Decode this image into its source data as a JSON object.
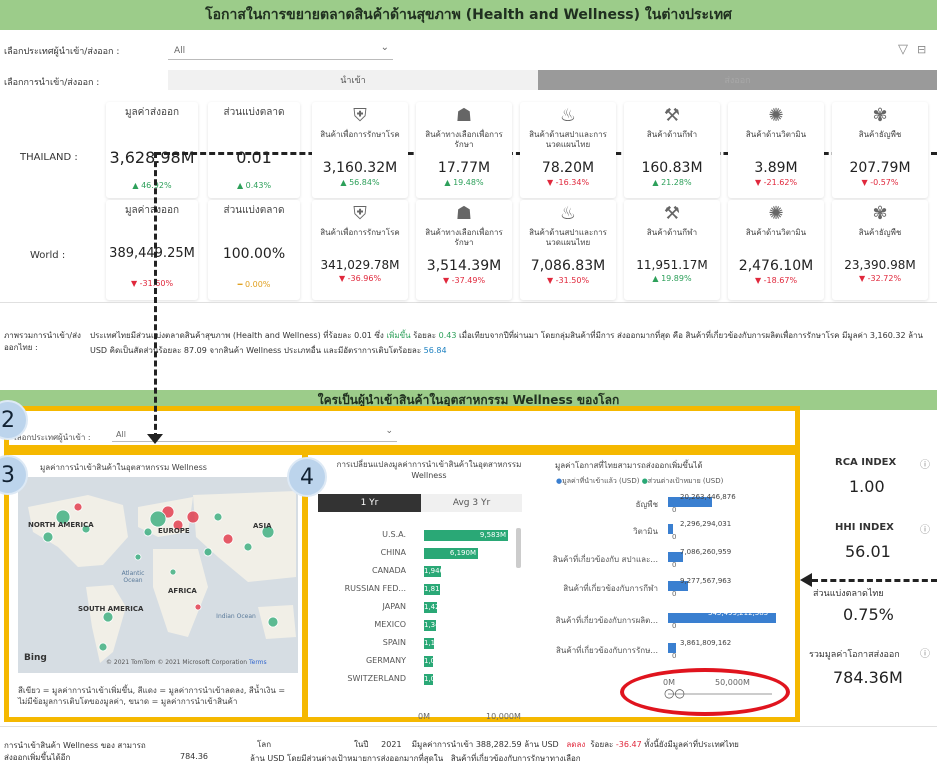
{
  "header": {
    "title": "โอกาสในการขยายตลาดสินค้าด้านสุขภาพ (Health and Wellness) ในต่างประเทศ"
  },
  "filters": {
    "country_label": "เลือกประเทศผู้นำเข้า/ส่งออก :",
    "country_value": "All",
    "mode_label": "เลือกการนำเข้า/ส่งออก :",
    "mode_import": "นำเข้า",
    "mode_export": "ส่งออก"
  },
  "kpi_headers": {
    "export_value": "มูลค่าส่งออก",
    "market_share": "ส่วนแบ่งตลาด"
  },
  "thailand": {
    "label": "THAILAND :",
    "export_value": "3,628.98M",
    "export_change": "▲ 46.92%",
    "market_share": "0.01",
    "share_change": "▲ 0.43%",
    "products": [
      {
        "icon": "shield-icon",
        "glyph": "⛨",
        "title": "สินค้าเพื่อการรักษาโรค",
        "value": "3,160.32M",
        "change": "▲ 56.84%",
        "dir": "up"
      },
      {
        "icon": "alt-medicine-icon",
        "glyph": "☗",
        "title": "สินค้าทางเลือกเพื่อการรักษา",
        "value": "17.77M",
        "change": "▲ 19.48%",
        "dir": "up"
      },
      {
        "icon": "spa-icon",
        "glyph": "♨",
        "title": "สินค้าด้านสปาและการนวดแผนไทย",
        "value": "78.20M",
        "change": "▼ -16.34%",
        "dir": "down"
      },
      {
        "icon": "sport-icon",
        "glyph": "⚒",
        "title": "สินค้าด้านกีฬา",
        "value": "160.83M",
        "change": "▲ 21.28%",
        "dir": "up"
      },
      {
        "icon": "vitamin-icon",
        "glyph": "✺",
        "title": "สินค้าด้านวิตามิน",
        "value": "3.89M",
        "change": "▼ -21.62%",
        "dir": "down"
      },
      {
        "icon": "grain-icon",
        "glyph": "✾",
        "title": "สินค้าธัญพืช",
        "value": "207.79M",
        "change": "▼ -0.57%",
        "dir": "down"
      }
    ]
  },
  "world": {
    "label": "World :",
    "export_value": "389,449.25M",
    "export_change": "▼ -31.60%",
    "market_share": "100.00%",
    "share_change": "━ 0.00%",
    "products": [
      {
        "icon": "shield-icon",
        "glyph": "⛨",
        "title": "สินค้าเพื่อการรักษาโรค",
        "value": "341,029.78M",
        "change": "▼ -36.96%",
        "dir": "down"
      },
      {
        "icon": "alt-medicine-icon",
        "glyph": "☗",
        "title": "สินค้าทางเลือกเพื่อการรักษา",
        "value": "3,514.39M",
        "change": "▼ -37.49%",
        "dir": "down"
      },
      {
        "icon": "spa-icon",
        "glyph": "♨",
        "title": "สินค้าด้านสปาและการนวดแผนไทย",
        "value": "7,086.83M",
        "change": "▼ -31.50%",
        "dir": "down"
      },
      {
        "icon": "sport-icon",
        "glyph": "⚒",
        "title": "สินค้าด้านกีฬา",
        "value": "11,951.17M",
        "change": "▲ 19.89%",
        "dir": "up"
      },
      {
        "icon": "vitamin-icon",
        "glyph": "✺",
        "title": "สินค้าด้านวิตามิน",
        "value": "2,476.10M",
        "change": "▼ -18.67%",
        "dir": "down"
      },
      {
        "icon": "grain-icon",
        "glyph": "✾",
        "title": "สินค้าธัญพืช",
        "value": "23,390.98M",
        "change": "▼ -32.72%",
        "dir": "down"
      }
    ]
  },
  "summary": {
    "label": "ภาพรวมการนำเข้า/ส่งออกไทย :",
    "text1": "ประเทศไทยมีส่วนแบ่งตลาดสินค้าสุขภาพ (Health and Wellness) ที่ร้อยละ",
    "share": "0.01",
    "text2": "ซึ่ง",
    "trend": "เพิ่มขึ้น",
    "text3": "ร้อยละ",
    "pct": "0.43",
    "text4": "เมื่อเทียบจากปีที่ผ่านมา โดยกลุ่มสินค้าที่มีการ ส่งออกมากที่สุด คือ",
    "text5": "สินค้าที่เกี่ยวข้องกับการผลิตเพื่อการรักษาโรค",
    "text6": "มีมูลค่า",
    "value": "3,160.32",
    "text7": "ล้าน USD คิดเป็นสัดส่วนร้อยละ",
    "ratio": "87.09",
    "text8": "จากสินค้า Wellness ประเภทอื่น และมีอัตราการเติบโตร้อยละ",
    "growth": "56.84"
  },
  "section2": {
    "title": "ใครเป็นผู้นำเข้าสินค้าในอุตสาหกรรม Wellness ของโลก",
    "filter_label": "เลือกประเทศผู้นำเข้า :",
    "filter_value": "All"
  },
  "bubbles": [
    "2",
    "3",
    "4"
  ],
  "map": {
    "title": "มูลค่าการนำเข้าสินค้าในอุตสาหกรรม Wellness",
    "labels": [
      "NORTH AMERICA",
      "EUROPE",
      "ASIA",
      "Atlantic Ocean",
      "AFRICA",
      "SOUTH AMERICA",
      "Indian Ocean"
    ],
    "bing": "Bing",
    "copyright": "© 2021 TomTom © 2021 Microsoft Corporation",
    "terms": "Terms",
    "legend": "สีเขียว = มูลค่าการนำเข้าเพิ่มขึ้น, สีแดง = มูลค่าการนำเข้าลดลง, สีน้ำเงิน = ไม่มีข้อมูลการเติบโตของมูลค่า, ขนาด = มูลค่าการนำเข้าสินค้า"
  },
  "importers": {
    "title": "การเปลี่ยนแปลงมูลค่าการนำเข้าสินค้าในอุตสาหกรรม Wellness",
    "tab_1yr": "1 Yr",
    "tab_3yr": "Avg 3 Yr",
    "axis_min": "0M",
    "axis_max": "10,000M"
  },
  "opportunity": {
    "title": "มูลค่าโอกาสที่ไทยสามารถส่งออกเพิ่มขึ้นได้",
    "legend_import": "มูลค่าที่นำเข้าแล้ว (USD)",
    "legend_target": "ส่วนต่างเป้าหมาย (USD)",
    "axis_min": "0M",
    "axis_max": "50,000M"
  },
  "kpis": {
    "rca_label": "RCA INDEX",
    "rca_value": "1.00",
    "hhi_label": "HHI INDEX",
    "hhi_value": "56.01",
    "share_label": "ส่วนแบ่งตลาดไทย",
    "share_value": "0.75%",
    "total_label": "รวมมูลค่าโอกาสส่งออก",
    "total_value": "784.36M"
  },
  "footer": {
    "label": "การนำเข้าสินค้า Wellness ของ สามารถส่งออกเพิ่มขึ้นได้อีก",
    "world": "โลก",
    "amount": "784.36",
    "in_year": "ในปี",
    "year": "2021",
    "text1": "มีมูลค่าการนำเข้า",
    "import_value": "388,282.59",
    "text2": "ล้าน USD",
    "trend": "ลดลง",
    "text3": "ร้อยละ",
    "pct": "-36.47",
    "text4": "ทั้งนี้ยังมีมูลค่าที่ประเทศไทย",
    "text5": "ล้าน USD โดยมีส่วนต่างเป้าหมายการส่งออกมากที่สุดใน",
    "text6": "สินค้าที่เกี่ยวข้องกับการรักษาทางเลือก"
  },
  "chart_data": [
    {
      "type": "bar",
      "title": "การเปลี่ยนแปลงมูลค่าการนำเข้าสินค้าในอุตสาหกรรม Wellness",
      "orientation": "horizontal",
      "categories": [
        "U.S.A.",
        "CHINA",
        "CANADA",
        "RUSSIAN FED...",
        "JAPAN",
        "MEXICO",
        "SPAIN",
        "GERMANY",
        "SWITZERLAND"
      ],
      "values": [
        9583,
        6190,
        1946,
        1813,
        1422,
        1347,
        1135,
        1064,
        1031
      ],
      "value_labels": [
        "9,583M",
        "6,190M",
        "1,946M",
        "1,813M",
        "1,422M",
        "1,347M",
        "1,135M",
        "1,064M",
        "1,031M"
      ],
      "xlim": [
        0,
        10000
      ],
      "color": "#2aa876"
    },
    {
      "type": "bar",
      "title": "มูลค่าโอกาสที่ไทยสามารถส่งออกเพิ่มขึ้นได้",
      "orientation": "horizontal",
      "categories": [
        "ธัญพืช",
        "วิตามิน",
        "สินค้าที่เกี่ยวข้องกับ สปาและ...",
        "สินค้าที่เกี่ยวข้องกับการกีฬา",
        "สินค้าที่เกี่ยวข้องกับการผลิต...",
        "สินค้าที่เกี่ยวข้องกับการรักษ..."
      ],
      "series": [
        {
          "name": "มูลค่าที่นำเข้าแล้ว (USD)",
          "values": [
            20263446876,
            2296294031,
            7086260959,
            9277567963,
            345499212383,
            3861809162
          ]
        },
        {
          "name": "ส่วนต่างเป้าหมาย (USD)",
          "values": [
            0,
            0,
            0,
            0,
            0,
            0
          ]
        }
      ],
      "value_labels": [
        "20,263,446,876",
        "2,296,294,031",
        "7,086,260,959",
        "9,277,567,963",
        "345,499,212,383",
        "3,861,809,162"
      ],
      "xlim": [
        0,
        50000000000
      ],
      "colors": [
        "#3a7fd0",
        "#2aa876"
      ]
    }
  ]
}
